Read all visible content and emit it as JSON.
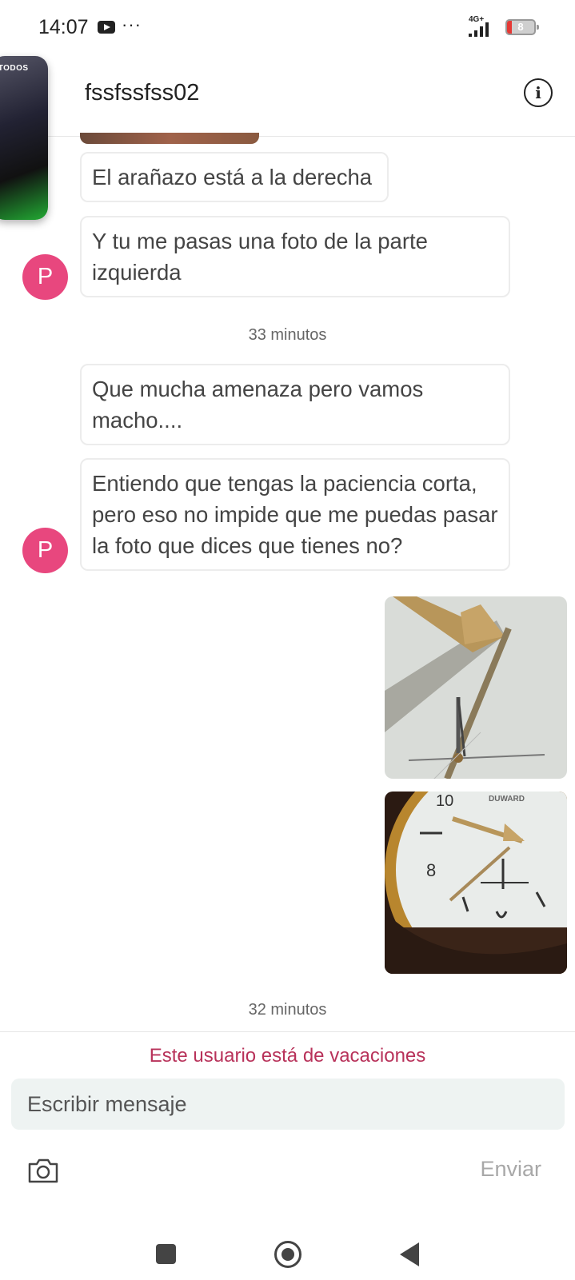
{
  "status_bar": {
    "time": "14:07",
    "more": "···",
    "network": "4G+",
    "battery": "8"
  },
  "header": {
    "username": "fssfssfss02",
    "info_icon": "i"
  },
  "pip": {
    "label": "UTODOS"
  },
  "messages": [
    {
      "text": "El arañazo está a la derecha"
    },
    {
      "text": "Y tu me pasas una foto de la parte izquierda"
    },
    {
      "text": "Que mucha amenaza pero vamos macho...."
    },
    {
      "text": "Entiendo que tengas la paciencia corta, pero eso no impide que me puedas pasar la foto que dices que tienes no?"
    }
  ],
  "avatar_letter": "P",
  "timestamps": [
    "33 minutos",
    "32 minutos"
  ],
  "photos": {
    "brand": "DUWARD",
    "numeral_10": "10",
    "numeral_8": "8"
  },
  "composer": {
    "vacation_notice": "Este usuario está de vacaciones",
    "placeholder": "Escribir mensaje",
    "send_label": "Enviar"
  },
  "icons": [
    "youtube-icon",
    "signal-icon",
    "battery-icon",
    "info-icon",
    "avatar",
    "camera-icon",
    "nav-recent-icon",
    "nav-home-icon",
    "nav-back-icon"
  ],
  "colors": {
    "avatar": "#e8477e",
    "vacation": "#b8325a",
    "input_bg": "#eef3f2"
  }
}
